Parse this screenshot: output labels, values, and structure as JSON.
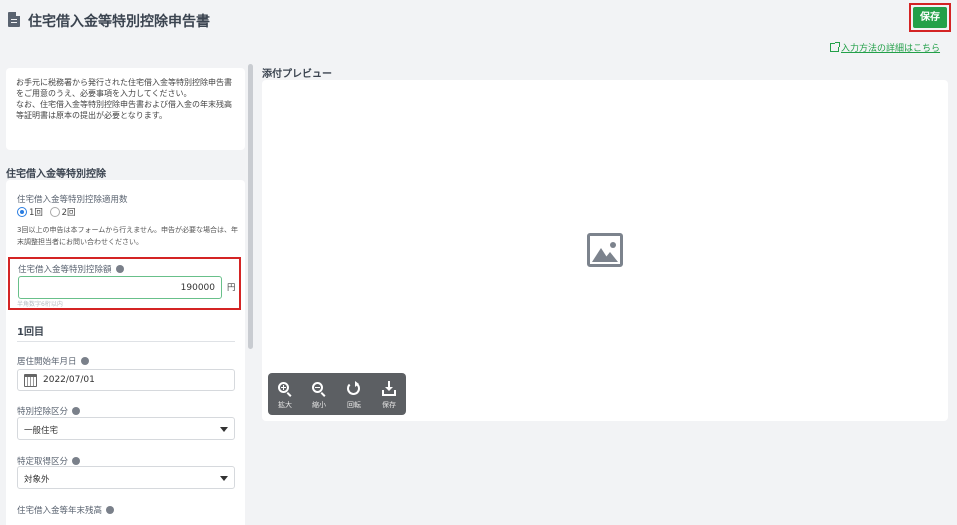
{
  "header": {
    "title": "住宅借入金等特別控除申告書",
    "save_label": "保存",
    "help_link": "入力方法の詳細はこちら"
  },
  "notice": {
    "line1": "お手元に税務署から発行された住宅借入金等特別控除申告書をご用意のうえ、必要事項を入力してください。",
    "line2": "なお、住宅借入金等特別控除申告書および借入金の年末残高等証明書は原本の提出が必要となります。"
  },
  "section": {
    "title": "住宅借入金等特別控除"
  },
  "form": {
    "count_label": "住宅借入金等特別控除適用数",
    "option1": "1回",
    "option2": "2回",
    "selected_option": "1回",
    "count_note": "3回以上の申告は本フォームから行えません。申告が必要な場合は、年末調整担当者にお問い合わせください。",
    "amount_label": "住宅借入金等特別控除額",
    "amount_value": "190000",
    "amount_unit": "円",
    "amount_hint": "半角数字6桁以内",
    "sub_title": "1回目",
    "start_date_label": "居住開始年月日",
    "start_date_value": "2022/07/01",
    "category_label": "特別控除区分",
    "category_value": "一般住宅",
    "acquisition_label": "特定取得区分",
    "acquisition_value": "対象外",
    "balance_label": "住宅借入金等年末残高"
  },
  "preview": {
    "title": "添付プレビュー",
    "tools": {
      "zoom_in": "拡大",
      "zoom_out": "縮小",
      "rotate": "回転",
      "save": "保存"
    }
  },
  "colors": {
    "accent": "#23a049",
    "highlight": "#d42424",
    "radio": "#2a7de1"
  }
}
